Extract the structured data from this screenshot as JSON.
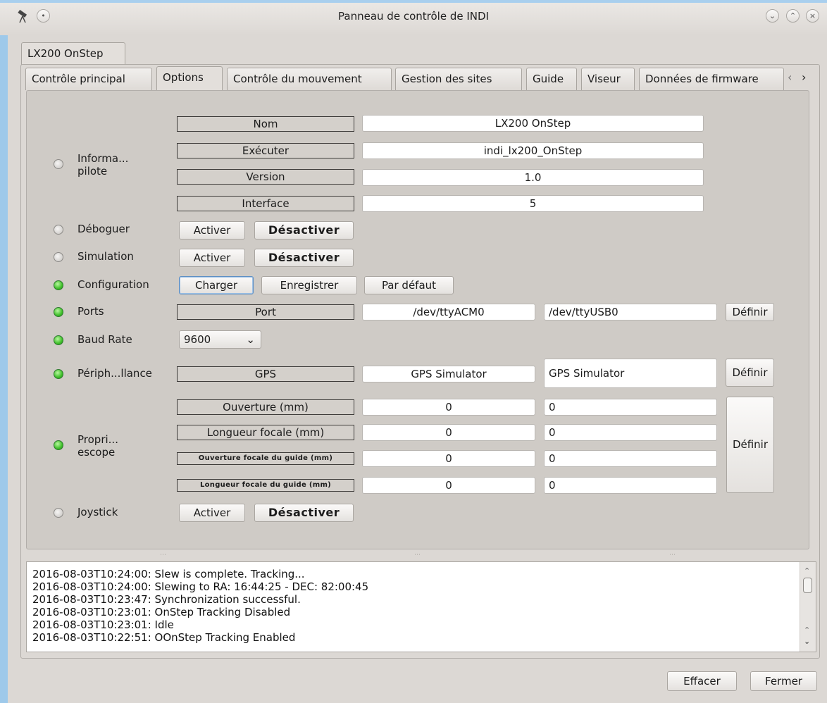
{
  "window": {
    "title": "Panneau de contrôle de INDI",
    "device_tab": "LX200 OnStep"
  },
  "tabs": [
    {
      "label": "Contrôle principal"
    },
    {
      "label": "Options"
    },
    {
      "label": "Contrôle du mouvement"
    },
    {
      "label": "Gestion des sites"
    },
    {
      "label": "Guide"
    },
    {
      "label": "Viseur"
    },
    {
      "label": "Données de firmware"
    }
  ],
  "driver_info": {
    "label_line1": "Informa...",
    "label_line2": "pilote",
    "rows": [
      {
        "name": "Nom",
        "value": "LX200 OnStep"
      },
      {
        "name": "Exécuter",
        "value": "indi_lx200_OnStep"
      },
      {
        "name": "Version",
        "value": "1.0"
      },
      {
        "name": "Interface",
        "value": "5"
      }
    ]
  },
  "debug": {
    "label": "Déboguer",
    "on": "Activer",
    "off": "Désactiver"
  },
  "simulation": {
    "label": "Simulation",
    "on": "Activer",
    "off": "Désactiver"
  },
  "configuration": {
    "label": "Configuration",
    "load": "Charger",
    "save": "Enregistrer",
    "default": "Par défaut"
  },
  "ports": {
    "label": "Ports",
    "name": "Port",
    "current": "/dev/ttyACM0",
    "input": "/dev/ttyUSB0",
    "set": "Définir"
  },
  "baud": {
    "label": "Baud Rate",
    "value": "9600"
  },
  "peripherals": {
    "label": "Périph...llance",
    "name": "GPS",
    "current": "GPS Simulator",
    "input": "GPS Simulator",
    "set": "Définir"
  },
  "telescope": {
    "label_line1": "Propri...",
    "label_line2": "escope",
    "set": "Définir",
    "rows": [
      {
        "name": "Ouverture (mm)",
        "current": "0",
        "input": "0"
      },
      {
        "name": "Longueur focale (mm)",
        "current": "0",
        "input": "0"
      },
      {
        "name": "Ouverture focale du guide (mm)",
        "current": "0",
        "input": "0"
      },
      {
        "name": "Longueur focale du guide (mm)",
        "current": "0",
        "input": "0"
      }
    ]
  },
  "joystick": {
    "label": "Joystick",
    "on": "Activer",
    "off": "Désactiver"
  },
  "log": [
    "2016-08-03T10:24:00: Slew is complete. Tracking...",
    "2016-08-03T10:24:00: Slewing to RA: 16:44:25 - DEC: 82:00:45",
    "2016-08-03T10:23:47: Synchronization successful.",
    "2016-08-03T10:23:01: OnStep Tracking Disabled",
    "2016-08-03T10:23:01: Idle",
    "2016-08-03T10:22:51: OOnStep Tracking Enabled"
  ],
  "footer": {
    "clear": "Effacer",
    "close": "Fermer"
  },
  "icons": {
    "app": "telescope-icon",
    "pin": "pin-icon",
    "minimize": "minimize-icon",
    "maximize": "maximize-icon",
    "close": "close-icon"
  }
}
